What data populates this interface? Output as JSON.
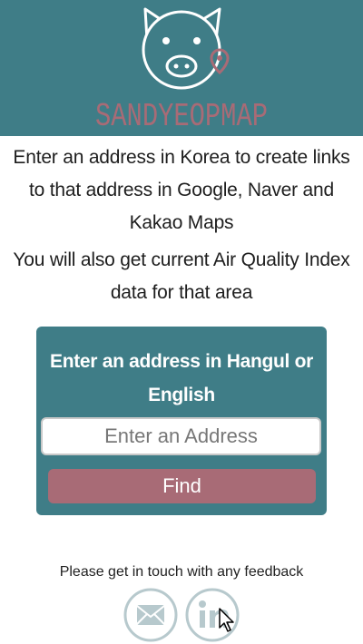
{
  "header": {
    "logo_text": "SANDYEOPMAP",
    "logo_icon": "pig-face-with-map-pin",
    "background": "#3f7d87",
    "logo_color": "#ffffff",
    "logo_text_color": "#a86b76"
  },
  "intro": {
    "line1": "Enter an address in Korea to create links to that address in Google, Naver and Kakao Maps",
    "line2": "You will also get current Air Quality Index data for that area"
  },
  "search_card": {
    "title": "Enter an address in Hangul or English",
    "input_placeholder": "Enter an Address",
    "input_value": "",
    "button_label": "Find",
    "card_color": "#3f7d87",
    "button_color": "#a86b76"
  },
  "footer": {
    "feedback_text": "Please get in touch with any feedback",
    "icons": [
      {
        "name": "mail-icon",
        "label": "Email"
      },
      {
        "name": "linkedin-icon",
        "label": "in"
      }
    ],
    "icon_color": "#b7c9cd"
  }
}
